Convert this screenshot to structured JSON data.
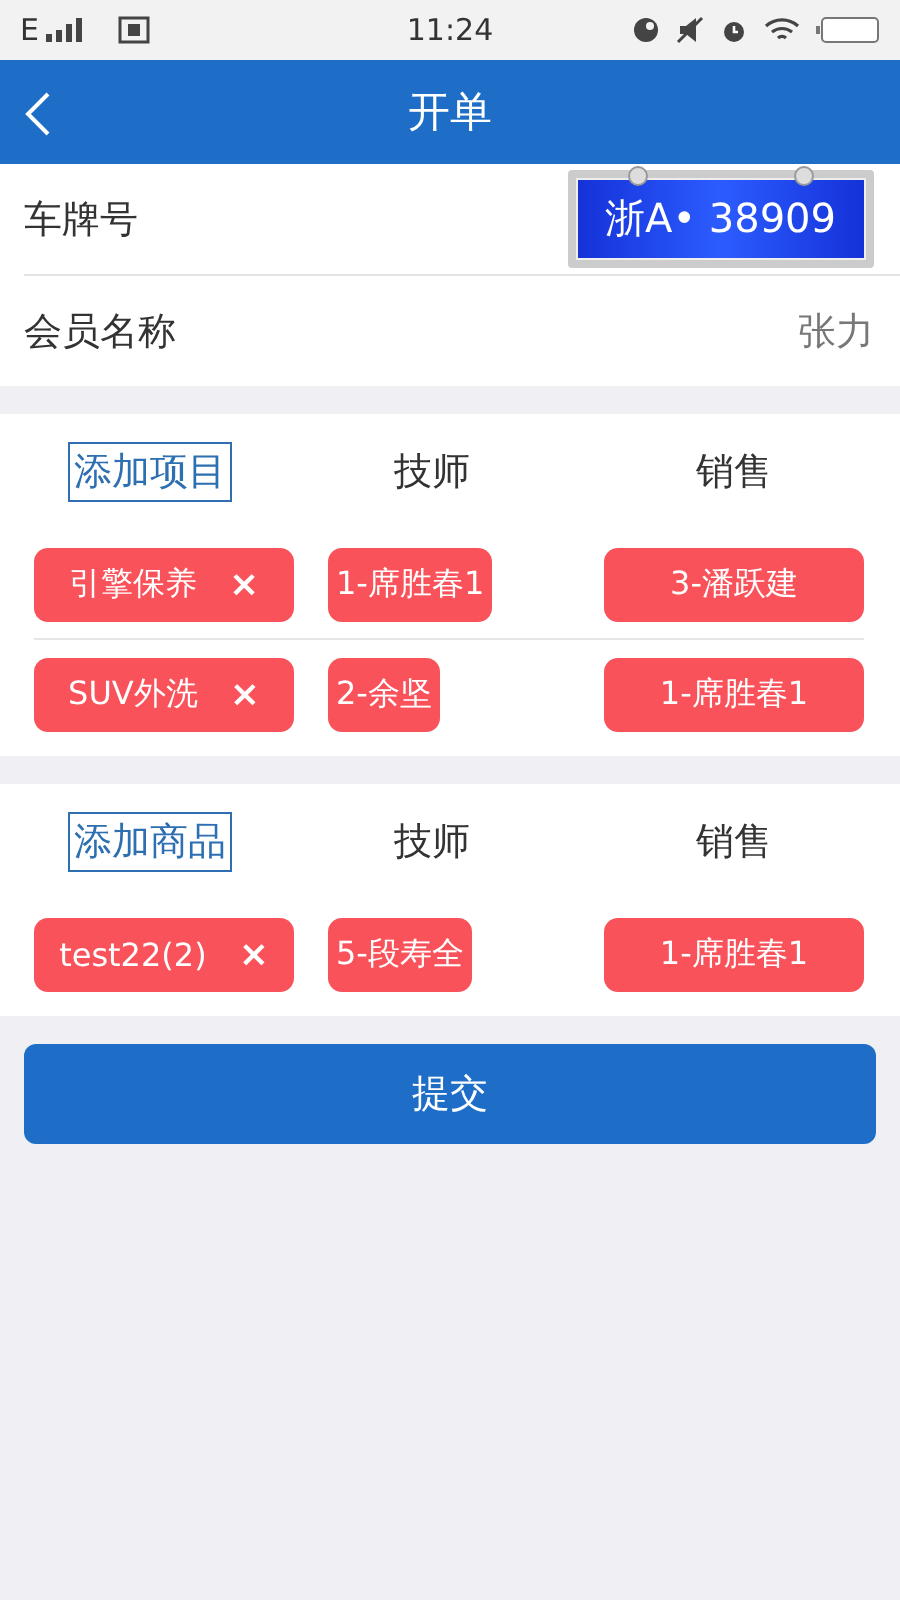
{
  "status_bar": {
    "network": "E",
    "time": "11:24"
  },
  "header": {
    "title": "开单"
  },
  "info_rows": [
    {
      "kind": "plate",
      "label": "车牌号",
      "value": "浙A• 38909"
    },
    {
      "kind": "text",
      "label": "会员名称",
      "value": "张力"
    }
  ],
  "sections": [
    {
      "add_label": "添加项目",
      "tech_label": "技师",
      "sales_label": "销售",
      "rows": [
        {
          "item": "引擎保养",
          "remove": "×",
          "tech": "1-席胜春1",
          "sales": "3-潘跃建"
        },
        {
          "item": "SUV外洗",
          "remove": "×",
          "tech": "2-余坚",
          "sales": "1-席胜春1"
        }
      ]
    },
    {
      "add_label": "添加商品",
      "tech_label": "技师",
      "sales_label": "销售",
      "rows": [
        {
          "item": "test22(2)",
          "remove": "×",
          "tech": "5-段寿全",
          "sales": "1-席胜春1"
        }
      ]
    }
  ],
  "submit": {
    "label": "提交"
  }
}
